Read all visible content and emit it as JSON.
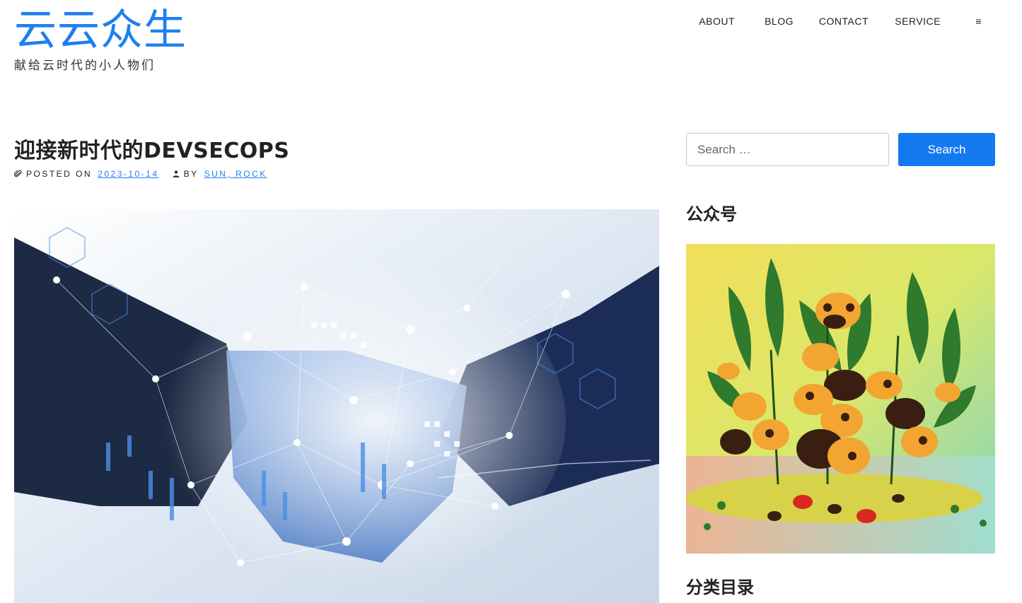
{
  "site": {
    "title": "云云众生",
    "description": "献给云时代的小人物们"
  },
  "nav": {
    "items": [
      "ABOUT",
      "BLOG",
      "CONTACT",
      "SERVICE"
    ],
    "menu_icon_glyph": "≡"
  },
  "post": {
    "title": "迎接新时代的DEVSECOPS",
    "posted_on_label": "POSTED ON",
    "date": "2023-10-14",
    "by_label": "BY",
    "authors": "SUN, ROCK"
  },
  "search": {
    "placeholder": "Search …",
    "button_label": "Search"
  },
  "sidebar": {
    "widget1_title": "公众号",
    "widget2_title": "分类目录"
  },
  "colors": {
    "accent": "#1e7ff0",
    "button": "#1479f0"
  }
}
